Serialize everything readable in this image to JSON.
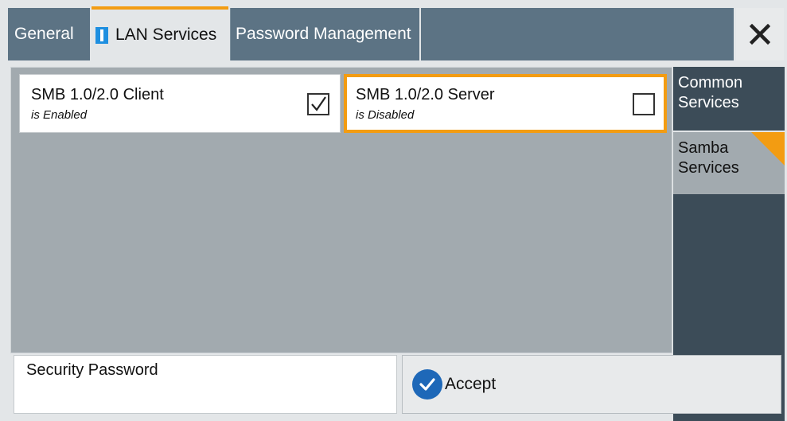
{
  "tabs": {
    "general": "General",
    "lan_services": "LAN Services",
    "password_management": "Password Management"
  },
  "close_icon": "close-icon",
  "smb_client": {
    "label": "SMB 1.0/2.0 Client",
    "status": "is Enabled",
    "checked": true
  },
  "smb_server": {
    "label": "SMB 1.0/2.0 Server",
    "status": "is Disabled",
    "checked": false
  },
  "side_menu": {
    "common_services": "Common\nServices",
    "samba_services": "Samba\nServices"
  },
  "security_password": {
    "label": "Security Password",
    "value": ""
  },
  "accept": {
    "label": "Accept",
    "icon": "checkmark-icon"
  },
  "colors": {
    "accent": "#f39c12",
    "tab_bg": "#5c7384",
    "panel_bg": "#a2aaaf",
    "side_dark": "#3c4c58",
    "accept_icon": "#1e68b8"
  }
}
